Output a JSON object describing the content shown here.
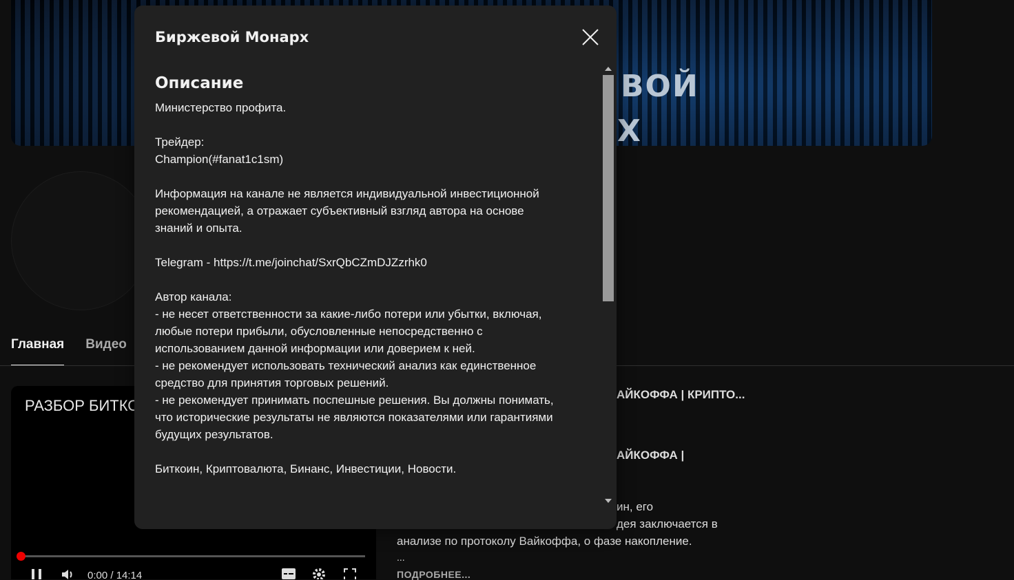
{
  "banner": {
    "word1": "ВОЙ",
    "word2": "Х"
  },
  "tabs": [
    {
      "label": "Главная",
      "active": true
    },
    {
      "label": "Видео",
      "active": false
    }
  ],
  "player": {
    "title": "РАЗБОР БИТКО",
    "time": "0:00 / 14:14",
    "progress": 0
  },
  "side": {
    "line1": "АЙКОФФА | КРИПТО...",
    "line2": "АЙКОФФА |",
    "line3": "ин, его",
    "line4": "дея заключается в",
    "line5": "анализе по протоколу Вайкоффа, о фазе накопление.",
    "ellipsis": "...",
    "more": "ПОДРОБНЕЕ..."
  },
  "modal": {
    "title": "Биржевой Монарх",
    "section_heading": "Описание",
    "paragraphs": [
      "Министерство профита.",
      "Трейдер:\nChampion(#fanat1c1sm)",
      "Информация на канале не является индивидуальной инвестиционной\nрекомендацией, а отражает субъективный взгляд автора на основе\nзнаний и опыта.",
      "Telegram - https://t.me/joinchat/SxrQbCZmDJZzrhk0",
      "Автор канала:\n- не несет ответственности за какие-либо потери или убытки, включая,\nлюбые потери прибыли, обусловленные непосредственно с\nиспользованием данной информации или доверием к ней.\n- не рекомендует использовать технический анализ как единственное\nсредство для принятия торговых решений.\n- не рекомендует принимать поспешные решения. Вы должны понимать,\nчто исторические результаты не являются показателями или гарантиями\nбудущих результатов.",
      "Биткоин, Криптовалюта, Бинанс, Инвестиции, Новости."
    ]
  },
  "icons": {
    "close": "close-icon",
    "pause": "pause-icon",
    "volume": "volume-icon",
    "subtitles": "subtitles-icon",
    "settings": "gear-icon",
    "fullscreen": "fullscreen-icon"
  },
  "colors": {
    "modal_bg": "#212121",
    "page_bg": "#0f0f0f",
    "progress": "#ee0000"
  }
}
